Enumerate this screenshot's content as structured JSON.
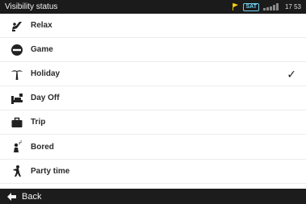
{
  "status_bar": {
    "title": "Visibility status",
    "sat_label": "SAT",
    "time": "17 53"
  },
  "items": [
    {
      "label": "Relax",
      "icon": "relax-icon",
      "selected": false
    },
    {
      "label": "Game",
      "icon": "game-icon",
      "selected": false
    },
    {
      "label": "Holiday",
      "icon": "palm-tree-icon",
      "selected": true
    },
    {
      "label": "Day Off",
      "icon": "day-off-icon",
      "selected": false
    },
    {
      "label": "Trip",
      "icon": "suitcase-icon",
      "selected": false
    },
    {
      "label": "Bored",
      "icon": "bored-icon",
      "selected": false
    },
    {
      "label": "Party time",
      "icon": "party-icon",
      "selected": false
    }
  ],
  "selected_mark": "✓",
  "bottom_bar": {
    "back_label": "Back"
  }
}
